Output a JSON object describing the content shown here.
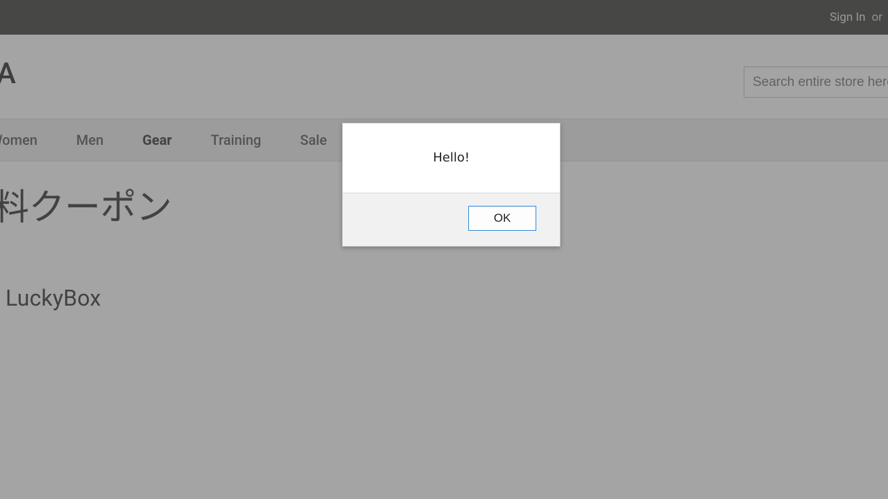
{
  "top_bar": {
    "sign_in": "Sign In",
    "or": "or"
  },
  "logo": "A",
  "search": {
    "placeholder": "Search entire store here"
  },
  "nav": {
    "items": [
      {
        "label": "Women",
        "partial": true,
        "active": false
      },
      {
        "label": "Men",
        "partial": false,
        "active": false
      },
      {
        "label": "Gear",
        "partial": false,
        "active": true
      },
      {
        "label": "Training",
        "partial": false,
        "active": false
      },
      {
        "label": "Sale",
        "partial": false,
        "active": false
      }
    ]
  },
  "page_heading": "料クーポン",
  "sub_heading": "LuckyBox",
  "dialog": {
    "message": "Hello!",
    "ok_label": "OK"
  }
}
